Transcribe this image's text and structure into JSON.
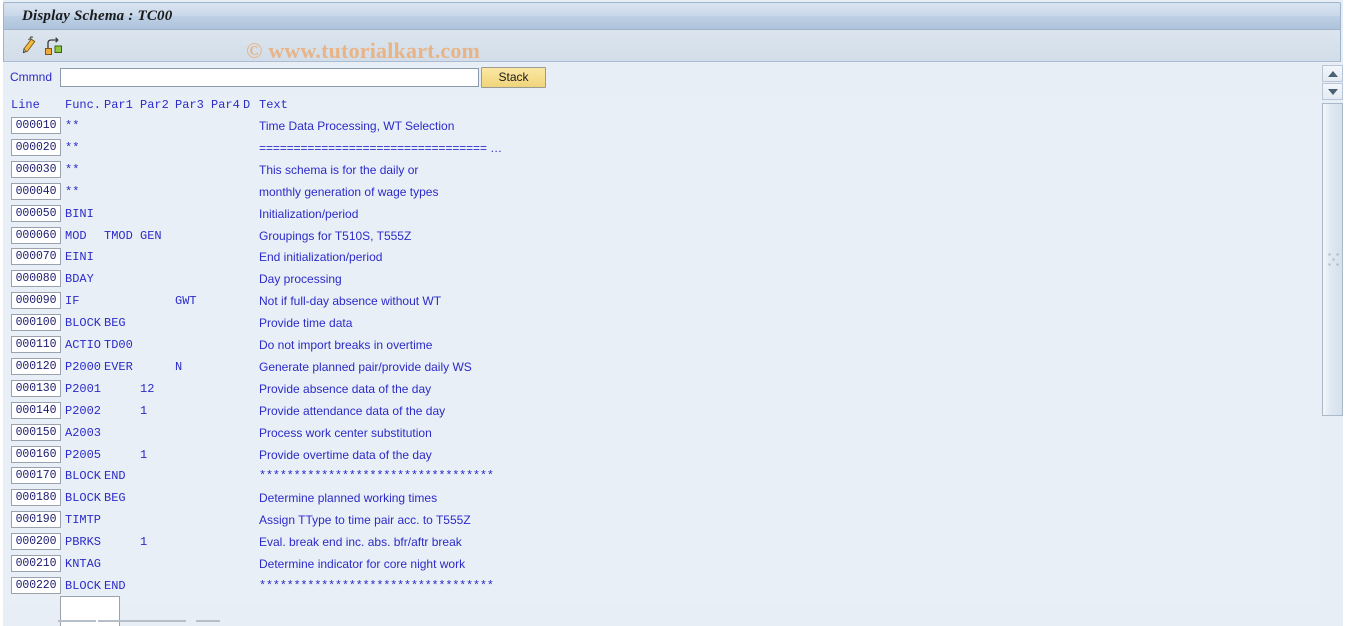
{
  "window": {
    "title": "Display Schema : TC00"
  },
  "toolbar": {
    "buttons": [
      {
        "name": "edit-schema-icon",
        "label": "Edit schema"
      },
      {
        "name": "schema-structure-icon",
        "label": "Schema structure"
      }
    ]
  },
  "watermark": {
    "text": "© www.tutorialkart.com",
    "color": "#e8b486"
  },
  "command": {
    "label": "Cmmnd",
    "value": "",
    "placeholder": "",
    "stack_label": "Stack"
  },
  "table": {
    "headers": {
      "line": "Line",
      "func": "Func.",
      "par1": "Par1",
      "par2": "Par2",
      "par3": "Par3",
      "par4": "Par4",
      "d": "D",
      "text": "Text"
    },
    "rows": [
      {
        "line": "000010",
        "func": "**",
        "par1": "",
        "par2": "",
        "par3": "",
        "par4": "",
        "d": "",
        "text": "Time Data Processing, WT Selection",
        "mono": false,
        "truncated": false
      },
      {
        "line": "000020",
        "func": "**",
        "par1": "",
        "par2": "",
        "par3": "",
        "par4": "",
        "d": "",
        "text": "=================================",
        "mono": true,
        "truncated": true
      },
      {
        "line": "000030",
        "func": "**",
        "par1": "",
        "par2": "",
        "par3": "",
        "par4": "",
        "d": "",
        "text": "This schema is for the daily or",
        "mono": false,
        "truncated": false
      },
      {
        "line": "000040",
        "func": "**",
        "par1": "",
        "par2": "",
        "par3": "",
        "par4": "",
        "d": "",
        "text": "monthly generation of wage types",
        "mono": false,
        "truncated": false
      },
      {
        "line": "000050",
        "func": "BINI",
        "par1": "",
        "par2": "",
        "par3": "",
        "par4": "",
        "d": "",
        "text": "Initialization/period",
        "mono": false,
        "truncated": false
      },
      {
        "line": "000060",
        "func": "MOD",
        "par1": "TMOD",
        "par2": "GEN",
        "par3": "",
        "par4": "",
        "d": "",
        "text": "Groupings for T510S, T555Z",
        "mono": false,
        "truncated": false
      },
      {
        "line": "000070",
        "func": "EINI",
        "par1": "",
        "par2": "",
        "par3": "",
        "par4": "",
        "d": "",
        "text": "End initialization/period",
        "mono": false,
        "truncated": false
      },
      {
        "line": "000080",
        "func": "BDAY",
        "par1": "",
        "par2": "",
        "par3": "",
        "par4": "",
        "d": "",
        "text": "Day processing",
        "mono": false,
        "truncated": false
      },
      {
        "line": "000090",
        "func": "IF",
        "par1": "",
        "par2": "",
        "par3": "GWT",
        "par4": "",
        "d": "",
        "text": "Not if full-day absence without WT",
        "mono": false,
        "truncated": false
      },
      {
        "line": "000100",
        "func": "BLOCK",
        "par1": "BEG",
        "par2": "",
        "par3": "",
        "par4": "",
        "d": "",
        "text": "Provide time data",
        "mono": false,
        "truncated": false
      },
      {
        "line": "000110",
        "func": "ACTIO",
        "par1": "TD00",
        "par2": "",
        "par3": "",
        "par4": "",
        "d": "",
        "text": "Do not import breaks in overtime",
        "mono": false,
        "truncated": false
      },
      {
        "line": "000120",
        "func": "P2000",
        "par1": "EVER",
        "par2": "",
        "par3": "N",
        "par4": "",
        "d": "",
        "text": "Generate planned pair/provide daily WS",
        "mono": false,
        "truncated": false
      },
      {
        "line": "000130",
        "func": "P2001",
        "par1": "",
        "par2": "12",
        "par3": "",
        "par4": "",
        "d": "",
        "text": "Provide absence data of the day",
        "mono": false,
        "truncated": false
      },
      {
        "line": "000140",
        "func": "P2002",
        "par1": "",
        "par2": "1",
        "par3": "",
        "par4": "",
        "d": "",
        "text": "Provide attendance data of the day",
        "mono": false,
        "truncated": false
      },
      {
        "line": "000150",
        "func": "A2003",
        "par1": "",
        "par2": "",
        "par3": "",
        "par4": "",
        "d": "",
        "text": "Process work center substitution",
        "mono": false,
        "truncated": false
      },
      {
        "line": "000160",
        "func": "P2005",
        "par1": "",
        "par2": "1",
        "par3": "",
        "par4": "",
        "d": "",
        "text": "Provide overtime data of the day",
        "mono": false,
        "truncated": false
      },
      {
        "line": "000170",
        "func": "BLOCK",
        "par1": "END",
        "par2": "",
        "par3": "",
        "par4": "",
        "d": "",
        "text": "**********************************",
        "mono": true,
        "truncated": false
      },
      {
        "line": "000180",
        "func": "BLOCK",
        "par1": "BEG",
        "par2": "",
        "par3": "",
        "par4": "",
        "d": "",
        "text": "Determine planned working times",
        "mono": false,
        "truncated": false
      },
      {
        "line": "000190",
        "func": "TIMTP",
        "par1": "",
        "par2": "",
        "par3": "",
        "par4": "",
        "d": "",
        "text": "Assign TType to time pair acc. to T555Z",
        "mono": false,
        "truncated": false
      },
      {
        "line": "000200",
        "func": "PBRKS",
        "par1": "",
        "par2": "1",
        "par3": "",
        "par4": "",
        "d": "",
        "text": "Eval. break end inc. abs. bfr/aftr break",
        "mono": false,
        "truncated": false
      },
      {
        "line": "000210",
        "func": "KNTAG",
        "par1": "",
        "par2": "",
        "par3": "",
        "par4": "",
        "d": "",
        "text": "Determine indicator for core night work",
        "mono": false,
        "truncated": false
      },
      {
        "line": "000220",
        "func": "BLOCK",
        "par1": "END",
        "par2": "",
        "par3": "",
        "par4": "",
        "d": "",
        "text": "**********************************",
        "mono": true,
        "truncated": false
      }
    ]
  },
  "scrollbar": {
    "up_label": "scroll up",
    "down_label": "scroll down"
  },
  "colors": {
    "text_blue": "#2b2bc8",
    "title_bar": "#bccfe4",
    "button_yellow": "#f6dd8d",
    "page_background": "#e9eff7"
  }
}
